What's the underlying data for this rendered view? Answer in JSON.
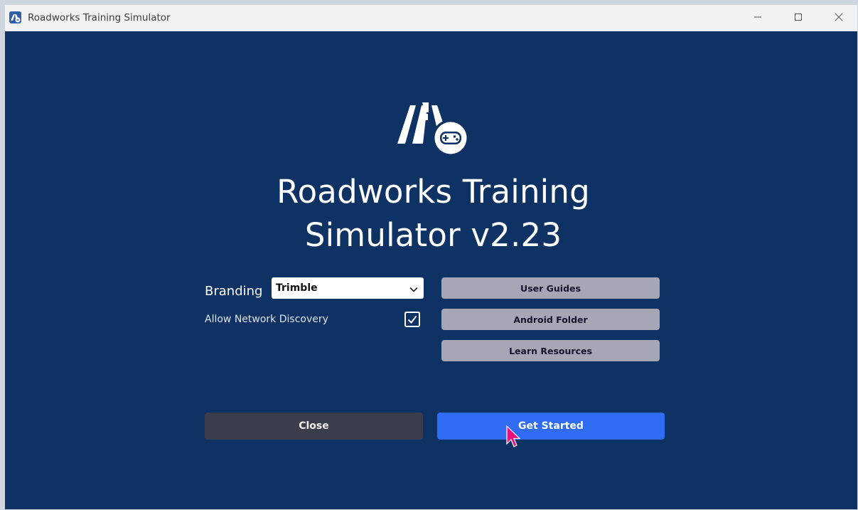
{
  "window": {
    "title": "Roadworks Training Simulator",
    "icons": {
      "app": "app-logo-icon",
      "minimize": "minimize-icon",
      "maximize": "maximize-icon",
      "close": "close-icon"
    }
  },
  "logo": {
    "icon": "road-gamepad-logo-icon"
  },
  "headline": {
    "line1": "Roadworks Training",
    "line2": "Simulator v2.23"
  },
  "settings": {
    "branding_label": "Branding",
    "branding_value": "Trimble",
    "network_discovery_label": "Allow Network Discovery",
    "network_discovery_checked": true
  },
  "links": {
    "user_guides": "User Guides",
    "android_folder": "Android Folder",
    "learn_resources": "Learn Resources"
  },
  "actions": {
    "close": "Close",
    "get_started": "Get Started"
  },
  "colors": {
    "background": "#0f3264",
    "primary_button": "#2f6cf2",
    "secondary_button": "#3b3d4b",
    "link_button": "#a7a6b4",
    "cursor": "#e6117f"
  }
}
